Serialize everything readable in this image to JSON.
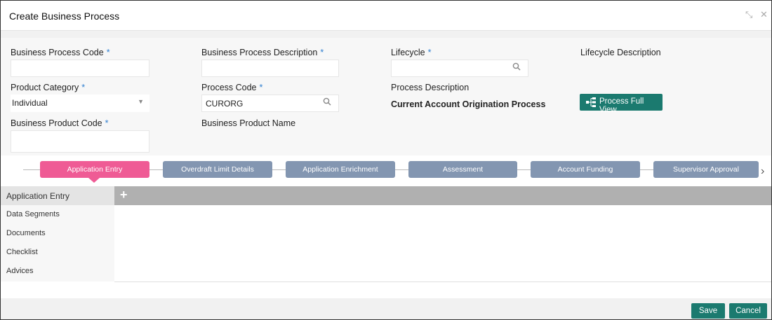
{
  "window": {
    "title": "Create Business Process",
    "minimize_glyph": "⤡",
    "close_glyph": "✕"
  },
  "form": {
    "required_mark": "*",
    "business_process_code": {
      "label": "Business Process Code",
      "value": ""
    },
    "business_process_description": {
      "label": "Business Process Description",
      "value": ""
    },
    "lifecycle": {
      "label": "Lifecycle",
      "value": "",
      "icon": "search-icon"
    },
    "lifecycle_description": {
      "label": "Lifecycle Description"
    },
    "product_category": {
      "label": "Product Category",
      "value": "Individual",
      "icon": "chevron-down-icon"
    },
    "process_code": {
      "label": "Process Code",
      "value": "CURORG",
      "icon": "search-icon"
    },
    "process_description": {
      "label": "Process Description",
      "value": "Current Account Origination Process"
    },
    "process_full_view": {
      "label": "Process Full View",
      "icon": "process-tree-icon"
    },
    "business_product_code": {
      "label": "Business Product Code",
      "value": ""
    },
    "business_product_name": {
      "label": "Business Product Name"
    }
  },
  "stages": [
    {
      "label": "Application Entry",
      "active": true
    },
    {
      "label": "Overdraft Limit Details",
      "active": false
    },
    {
      "label": "Application Enrichment",
      "active": false
    },
    {
      "label": "Assessment",
      "active": false
    },
    {
      "label": "Account Funding",
      "active": false
    },
    {
      "label": "Supervisor Approval",
      "active": false
    }
  ],
  "stage_next_glyph": "›",
  "sidebar": {
    "items": [
      {
        "label": "Application Entry",
        "selected": true
      },
      {
        "label": "Data Segments",
        "selected": false
      },
      {
        "label": "Documents",
        "selected": false
      },
      {
        "label": "Checklist",
        "selected": false
      },
      {
        "label": "Advices",
        "selected": false
      }
    ]
  },
  "toolbar": {
    "add_glyph": "+"
  },
  "footer": {
    "save_label": "Save",
    "cancel_label": "Cancel"
  },
  "colors": {
    "accent": "#1b7a6f",
    "stage_active": "#ef5b95",
    "stage_inactive": "#8396b1",
    "required": "#2f7fd0"
  }
}
